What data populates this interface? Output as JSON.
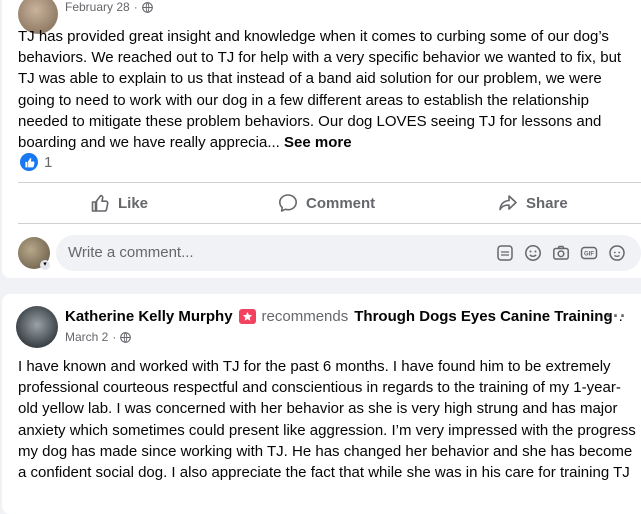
{
  "post1": {
    "date": "February 28",
    "text": "TJ has provided great insight and knowledge when it comes to curbing some of our dog’s behaviors. We reached out to TJ for help with a very specific behavior we wanted to fix, but TJ was able to explain to us that instead of a band aid solution for our problem, we were going to need to work with our dog in a few different areas to establish the relationship needed to mitigate these problem behaviors. Our dog LOVES seeing TJ for lessons and boarding and we have really apprecia... ",
    "see_more": "See more",
    "reaction_count": "1",
    "actions": {
      "like": "Like",
      "comment": "Comment",
      "share": "Share"
    },
    "comment_placeholder": "Write a comment..."
  },
  "post2": {
    "author": "Katherine Kelly Murphy",
    "recommends": "recommends",
    "page": "Through Dogs Eyes Canine Training",
    "date": "March 2",
    "text": "I have known and worked with TJ for the past 6 months. I have found him to be extremely professional courteous respectful and conscientious in regards to the training of my 1-year-old yellow lab. I was concerned with her behavior as she is very high strung and has major anxiety which sometimes could present like aggression. I’m very impressed with the progress my dog has made since working with TJ. He has changed her behavior and she has become a confident social dog. I also appreciate the fact that while she was in his care for training TJ"
  },
  "colors": {
    "link_blue": "#1877f2",
    "recommend_red": "#f3425f",
    "muted": "#65676b"
  },
  "icons": [
    "globe-icon",
    "like-reaction-icon",
    "thumbs-up-icon",
    "comment-bubble-icon",
    "share-arrow-icon",
    "sticker-icon",
    "emoji-icon",
    "camera-icon",
    "gif-icon",
    "avatar-sticker-icon",
    "recommend-badge-icon",
    "more-options-icon"
  ]
}
